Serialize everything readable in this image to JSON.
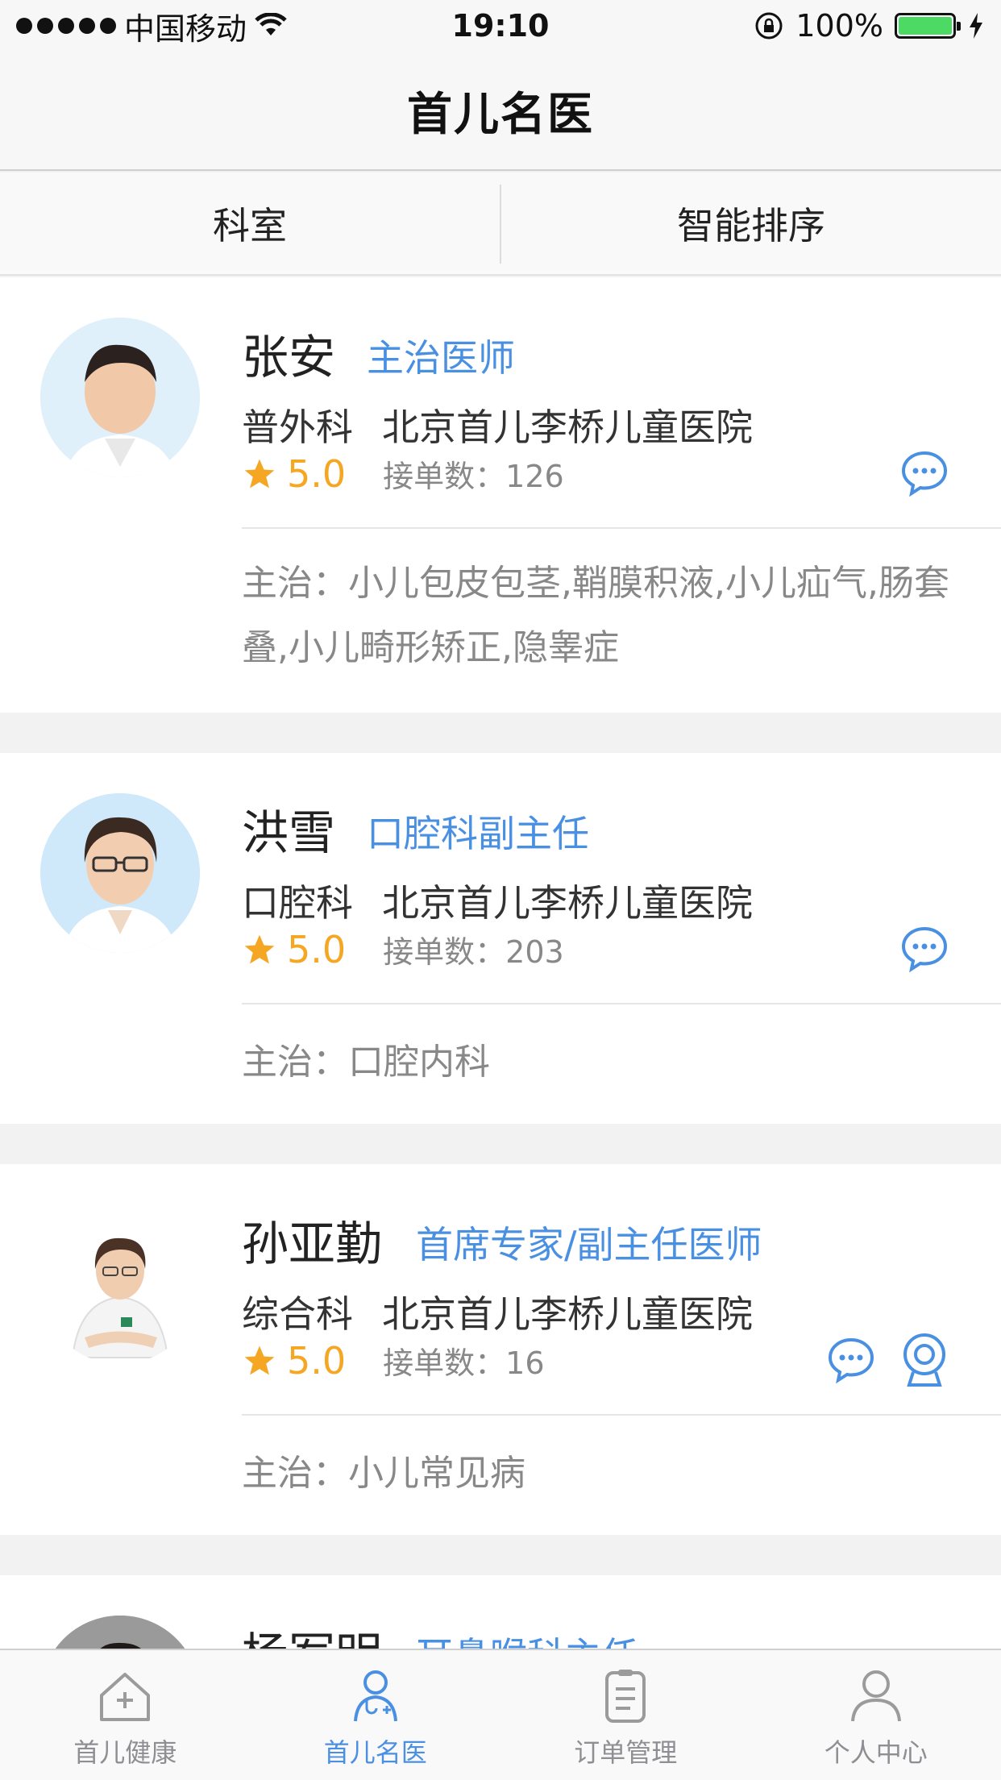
{
  "status_bar": {
    "carrier": "中国移动",
    "time": "19:10",
    "battery": "100%",
    "battery_color": "#4cd964"
  },
  "nav": {
    "title": "首儿名医"
  },
  "filters": {
    "department": "科室",
    "sort": "智能排序"
  },
  "accent_color": "#4a90e2",
  "rating_color": "#f5a623",
  "doctors": [
    {
      "name": "张安",
      "title": "主治医师",
      "department": "普外科",
      "hospital": "北京首儿李桥儿童医院",
      "rating": "5.0",
      "orders_label": "接单数：126",
      "specialty": "主治：小儿包皮包茎,鞘膜积液,小儿疝气,肠套叠,小儿畸形矫正,隐睾症",
      "actions": [
        "chat-icon"
      ]
    },
    {
      "name": "洪雪",
      "title": "口腔科副主任",
      "department": "口腔科",
      "hospital": "北京首儿李桥儿童医院",
      "rating": "5.0",
      "orders_label": "接单数：203",
      "specialty": "主治：口腔内科",
      "actions": [
        "chat-icon"
      ]
    },
    {
      "name": "孙亚勤",
      "title": "首席专家/副主任医师",
      "department": "综合科",
      "hospital": "北京首儿李桥儿童医院",
      "rating": "5.0",
      "orders_label": "接单数：16",
      "specialty": "主治：小儿常见病",
      "actions": [
        "chat-icon",
        "video-icon"
      ]
    },
    {
      "name": "杨军明",
      "title": "耳鼻喉科主任"
    }
  ],
  "tabs": [
    {
      "label": "首儿健康",
      "icon": "health-house-icon",
      "active": false
    },
    {
      "label": "首儿名医",
      "icon": "doctor-icon",
      "active": true
    },
    {
      "label": "订单管理",
      "icon": "clipboard-icon",
      "active": false
    },
    {
      "label": "个人中心",
      "icon": "person-icon",
      "active": false
    }
  ]
}
